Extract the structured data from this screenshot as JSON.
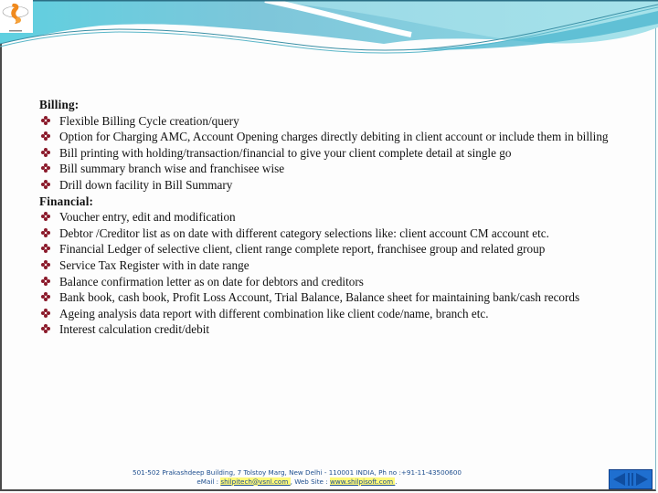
{
  "billing": {
    "title": "Billing:",
    "items": [
      {
        "text": "Flexible Billing Cycle creation/query"
      },
      {
        "text": "Option for Charging  AMC, Account Opening charges directly debiting in client account or include them in billing"
      },
      {
        "text": "Bill printing with holding/transaction/financial to give your client complete detail at single go"
      },
      {
        "text": "Bill summary branch wise and franchisee wise"
      },
      {
        "text": "Drill down facility in Bill Summary"
      }
    ]
  },
  "financial": {
    "title": "Financial:",
    "items": [
      {
        "text": "Voucher entry, edit and modification"
      },
      {
        "text": "Debtor /Creditor list as on date with different category selections like: client account CM account etc."
      },
      {
        "text": "Financial Ledger of selective client, client range complete report, franchisee group and related group"
      },
      {
        "text": "Service Tax Register with in date range"
      },
      {
        "text": "Balance confirmation letter as on date for debtors and creditors"
      },
      {
        "text": "Bank book, cash book, Profit Loss Account, Trial Balance, Balance sheet for maintaining bank/cash records"
      },
      {
        "text": "Ageing analysis data report with different combination like client code/name, branch etc."
      },
      {
        "text": "Interest calculation credit/debit"
      }
    ]
  },
  "footer": {
    "address": "501-502 Prakashdeep Building, 7 Tolstoy Marg, New Delhi - 110001 INDIA,  Ph no :+91-11-43500600",
    "email_label": "eMail : ",
    "email": "shilpitech@vsnl.com ",
    "web_label": " , Web Site : ",
    "website": " www.shilpisoft.com ",
    "end": " ."
  },
  "icons": {
    "bullet": "diamond-four-petal-bullet",
    "logo": "company-logo",
    "nav": "prev-next-navigation"
  },
  "colors": {
    "bullet": "#8b1a2b",
    "header_teal": "#6cc9dc",
    "footer_text": "#1f4f8f",
    "link_highlight": "#fff97a",
    "nav_blue": "#1f6fd0"
  }
}
